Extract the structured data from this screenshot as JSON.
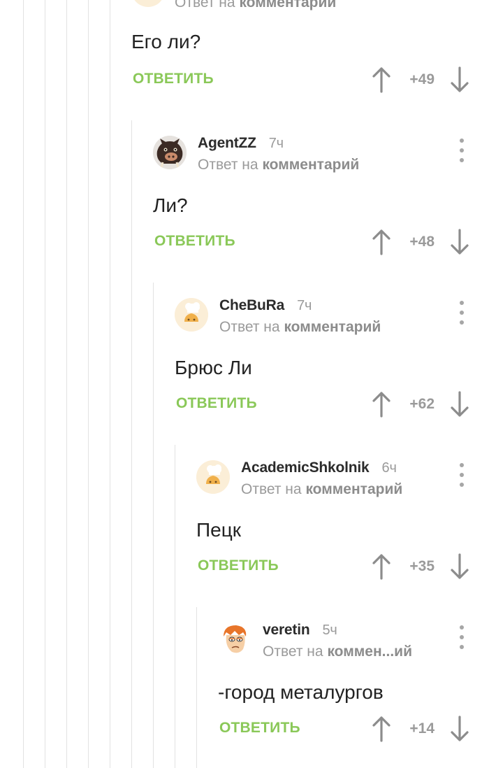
{
  "top_comment": {
    "reply_to_prefix": "Ответ на",
    "reply_to_target": "комментарий",
    "text": "Его ли?",
    "reply_label": "ОТВЕТИТЬ",
    "rating": "+49"
  },
  "comments": [
    {
      "author": "AgentZZ",
      "time": "7ч",
      "reply_to_prefix": "Ответ на",
      "reply_to_target": "комментарий",
      "text": "Ли?",
      "reply_label": "ОТВЕТИТЬ",
      "rating": "+48",
      "avatar": "pig-avatar"
    },
    {
      "author": "CheBuRa",
      "time": "7ч",
      "reply_to_prefix": "Ответ на",
      "reply_to_target": "комментарий",
      "text": "Брюс Ли",
      "reply_label": "ОТВЕТИТЬ",
      "rating": "+62",
      "avatar": "chef-hat-avatar"
    },
    {
      "author": "AcademicShkolnik",
      "time": "6ч",
      "reply_to_prefix": "Ответ на",
      "reply_to_target": "комментарий",
      "text": "Пецк",
      "reply_label": "ОТВЕТИТЬ",
      "rating": "+35",
      "avatar": "chef-hat-avatar"
    },
    {
      "author": "veretin",
      "time": "5ч",
      "reply_to_prefix": "Ответ на",
      "reply_to_target": "коммен...ий",
      "text": "-город металургов",
      "reply_label": "ОТВЕТИТЬ",
      "rating": "+14",
      "avatar": "fry-avatar"
    }
  ],
  "colors": {
    "reply_green": "#8ac858",
    "muted_gray": "#9a9a9a",
    "thread_line": "#e2e2e2"
  }
}
